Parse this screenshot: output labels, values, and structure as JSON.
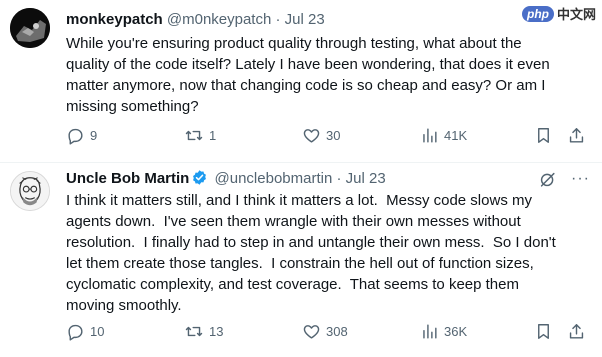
{
  "tweets": [
    {
      "author_name": "monkeypatch",
      "author_handle": "@m0nkeypatch",
      "separator": "·",
      "date": "Jul 23",
      "text": "While you're ensuring product quality through testing, what about the\nquality of the code itself? Lately I have been wondering, that does it even\nmatter anymore, now that changing code is so cheap and easy? Or am I\nmissing something?",
      "replies": "9",
      "reposts": "1",
      "likes": "30",
      "views": "41K"
    },
    {
      "author_name": "Uncle Bob Martin",
      "author_handle": "@unclebobmartin",
      "separator": "·",
      "date": "Jul 23",
      "text": "I think it matters still, and I think it matters a lot.  Messy code slows my\nagents down.  I've seen them wrangle with their own messes without\nresolution.  I finally had to step in and untangle their own mess.  So I don't\nlet them create those tangles.  I constrain the hell out of function sizes,\ncyclomatic complexity, and test coverage.  That seems to keep them\nmoving smoothly.",
      "replies": "10",
      "reposts": "13",
      "likes": "308",
      "views": "36K"
    }
  ],
  "more_label": "···",
  "watermark": {
    "badge": "php",
    "text": "中文网"
  },
  "icons": {
    "reply": "reply-icon",
    "repost": "repost-icon",
    "like": "like-icon",
    "views": "views-icon",
    "bookmark": "bookmark-icon",
    "share": "share-icon",
    "grok": "grok-icon",
    "verified": "verified-badge-icon"
  },
  "colors": {
    "text": "#0f1419",
    "secondary": "#536471",
    "verified": "#1d9bf0"
  }
}
